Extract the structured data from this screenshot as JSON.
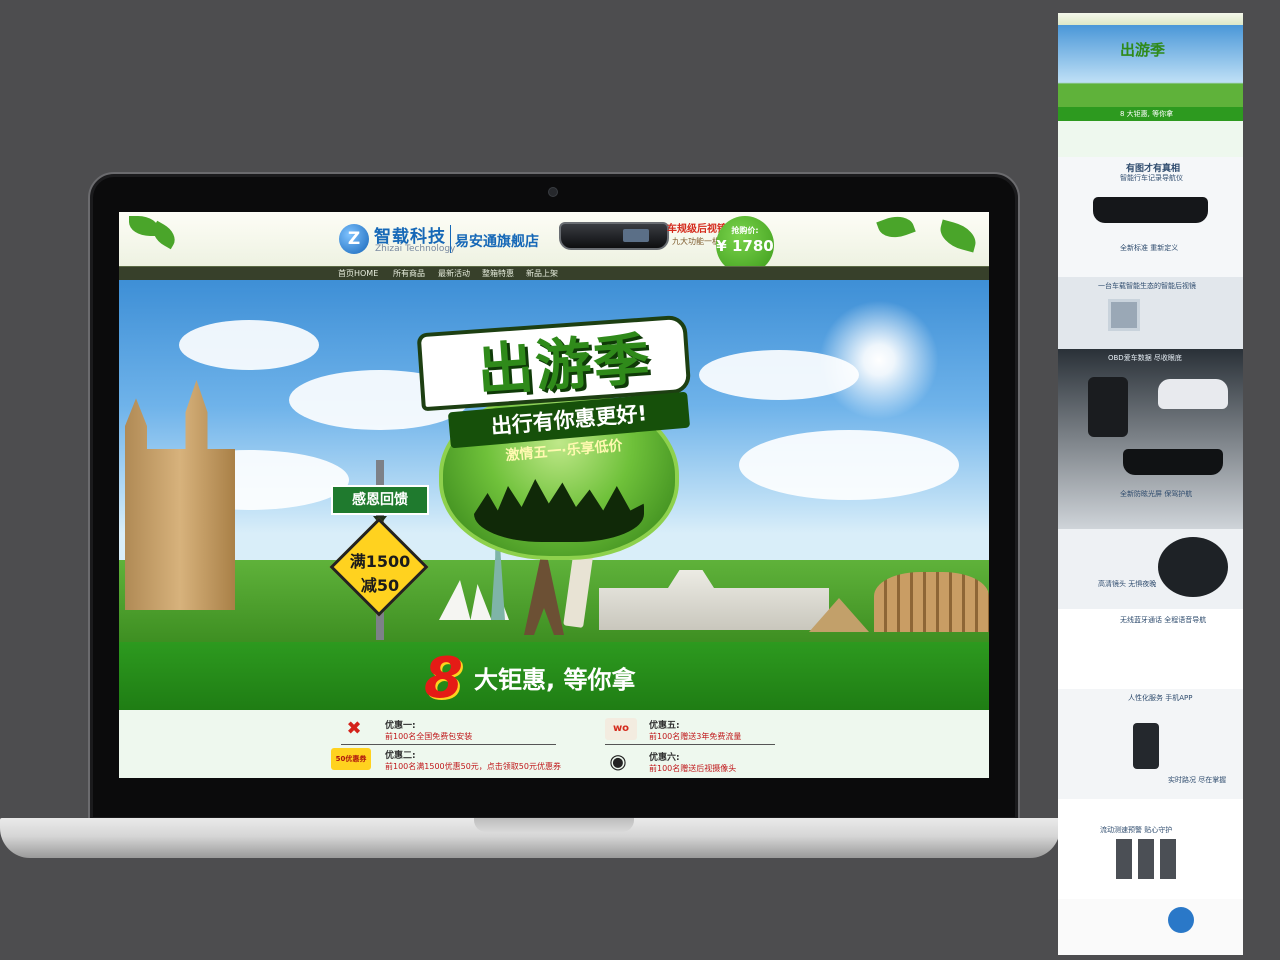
{
  "store": {
    "brand_name": "智载科技",
    "brand_sub": "Zhizai Technology",
    "store_name": "易安通旗舰店",
    "logo_glyph": "Z",
    "promo_title": "车规级后视镜导航",
    "promo_sub": "九大功能一机搞定",
    "price_label": "抢购价:",
    "price_value": "¥ 1780"
  },
  "nav": {
    "items": [
      "首页HOME",
      "所有商品",
      "最新活动",
      "整箱特惠",
      "新品上架"
    ]
  },
  "banner": {
    "title": "出游季",
    "subtitle": "出行有你惠更好!",
    "tagline": "激情五一·乐享低价",
    "sign_green": "感恩回馈",
    "sign_yellow_line1": "满1500",
    "sign_yellow_line2": "减50"
  },
  "offers": {
    "number": "8",
    "text": "大钜惠, 等你拿"
  },
  "deals": [
    {
      "title": "优惠一:",
      "desc": "前100名全国免费包安装",
      "icon": "wrench-icon",
      "glyph": "✖"
    },
    {
      "title": "优惠二:",
      "desc": "前100名满1500优惠50元，点击领取50元优惠券",
      "icon": "coupon-icon",
      "glyph": "50优惠券"
    },
    {
      "title": "优惠五:",
      "desc": "前100名赠送3年免费流量",
      "icon": "sim-card-icon",
      "glyph": "wo"
    },
    {
      "title": "优惠六:",
      "desc": "前100名赠送后视摄像头",
      "icon": "camera-icon",
      "glyph": "◉"
    }
  ],
  "preview": {
    "title": "出游季",
    "offer_line": "8 大钜惠, 等你拿",
    "section1": "有图才有真相",
    "section1_sub": "智能行车记录导航仪",
    "section2": "全新标准 重新定义",
    "section3": "一台车载智能生态的智能后视镜",
    "section4": "OBD爱车数据 尽收眼底",
    "section5": "全新防眩光屏 保驾护航",
    "section6": "高清镜头 无惧夜晚",
    "section7": "无线蓝牙通话 全程语音导航",
    "section8": "人性化服务 手机APP",
    "section9": "实时路况 尽在掌握",
    "section10": "流动测速预警 贴心守护"
  },
  "colors": {
    "brand_blue": "#1668b7",
    "banner_green": "#2d9a1f",
    "accent_red": "#e51b16",
    "sign_yellow": "#ffd21f"
  }
}
